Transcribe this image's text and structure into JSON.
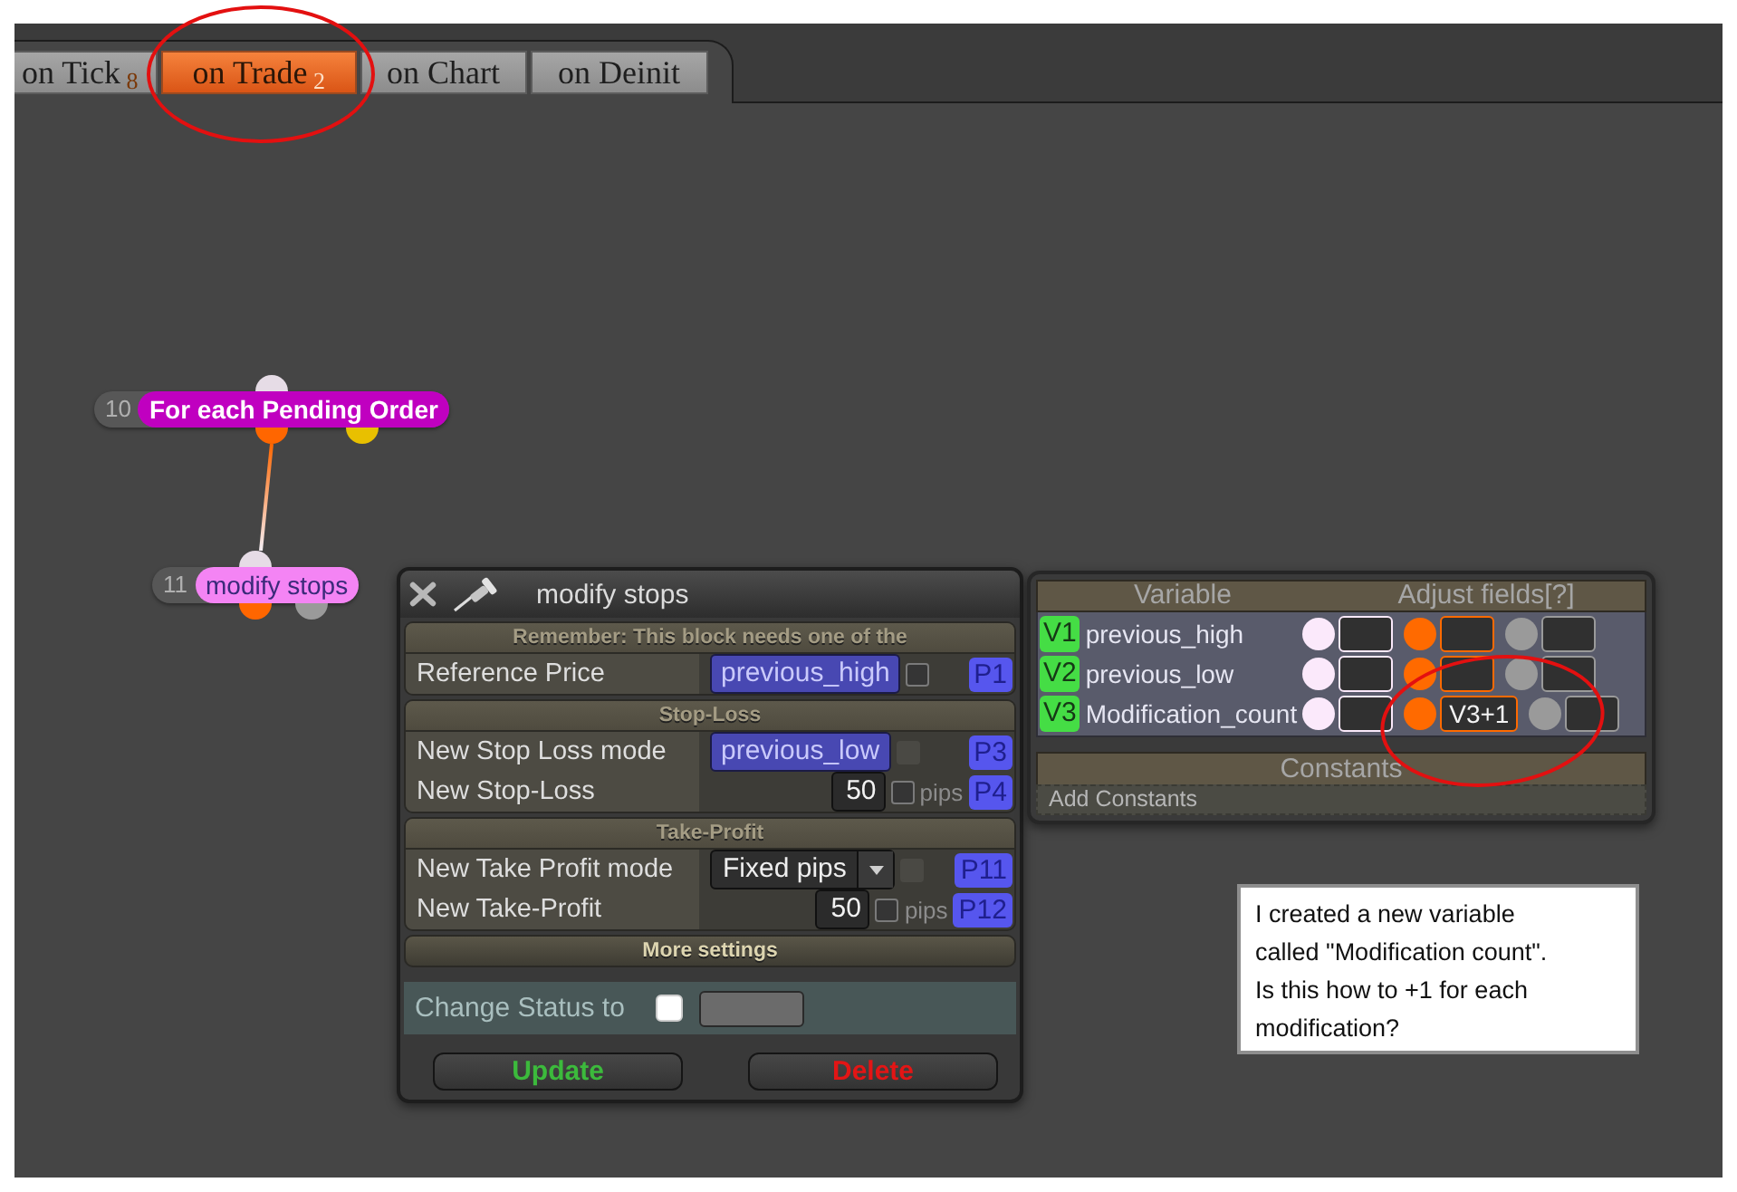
{
  "tabs": [
    {
      "label": "on Tick",
      "count": "8",
      "selected": false
    },
    {
      "label": "on Trade",
      "count": "2",
      "selected": true
    },
    {
      "label": "on Chart",
      "selected": false
    },
    {
      "label": "on Deinit",
      "selected": false
    }
  ],
  "nodes": [
    {
      "number": "10",
      "title": "For each Pending Order",
      "color": "#c000c0",
      "outputs": [
        {
          "color": "#ff6600"
        },
        {
          "color": "#e8c000"
        }
      ]
    },
    {
      "number": "11",
      "title": "modify stops",
      "color": "#f484f4",
      "outputs": [
        {
          "color": "#ff6600"
        },
        {
          "color": "#9a9a9a"
        }
      ]
    }
  ],
  "block_editor": {
    "title": "modify stops",
    "sections": [
      {
        "heading": "Remember: This block needs one of the",
        "rows": [
          {
            "label": "Reference Price",
            "kind": "variable",
            "value": "previous_high",
            "checkbox": {
              "checked": false,
              "disabled": false
            },
            "param": "P1"
          }
        ]
      },
      {
        "heading": "Stop-Loss",
        "rows": [
          {
            "label": "New Stop Loss mode",
            "kind": "variable",
            "value": "previous_low",
            "checkbox": {
              "checked": false,
              "disabled": true
            },
            "param": "P3"
          },
          {
            "label": "New Stop-Loss",
            "kind": "number",
            "value": "50",
            "checkbox": {
              "checked": false,
              "disabled": false
            },
            "unit": "pips",
            "param": "P4"
          }
        ]
      },
      {
        "heading": "Take-Profit",
        "rows": [
          {
            "label": "New Take Profit mode",
            "kind": "select",
            "value": "Fixed pips",
            "checkbox": {
              "checked": false,
              "disabled": true
            },
            "param": "P11"
          },
          {
            "label": "New Take-Profit",
            "kind": "number",
            "value": "50",
            "checkbox": {
              "checked": false,
              "disabled": false
            },
            "unit": "pips",
            "param": "P12"
          }
        ]
      }
    ],
    "more_settings": "More settings",
    "status": {
      "label": "Change Status to",
      "checked": false
    },
    "buttons": [
      {
        "label": "Update",
        "kind": "update"
      },
      {
        "label": "Delete",
        "kind": "delete"
      }
    ]
  },
  "variables_panel": {
    "columns": [
      "Variable",
      "Adjust fields[?]"
    ],
    "variables": [
      {
        "id": "V1",
        "name": "previous_high",
        "fields": [
          {
            "color": "#fbe9fb"
          },
          {
            "color": "#ff6a00"
          },
          {
            "color": "#9a9a9a"
          }
        ]
      },
      {
        "id": "V2",
        "name": "previous_low",
        "fields": [
          {
            "color": "#fbe9fb"
          },
          {
            "color": "#ff6a00"
          },
          {
            "color": "#9a9a9a"
          }
        ]
      },
      {
        "id": "V3",
        "name": "Modification_count",
        "fields": [
          {
            "color": "#fbe9fb"
          },
          {
            "color": "#ff6a00",
            "value": "V3+1"
          },
          {
            "color": "#9a9a9a"
          }
        ]
      }
    ],
    "constants_heading": "Constants",
    "add_constants": "Add Constants"
  },
  "note": {
    "lines": [
      "I created a new variable",
      "called \"Modification count\".",
      "Is this how to +1 for each",
      "modification?"
    ]
  }
}
